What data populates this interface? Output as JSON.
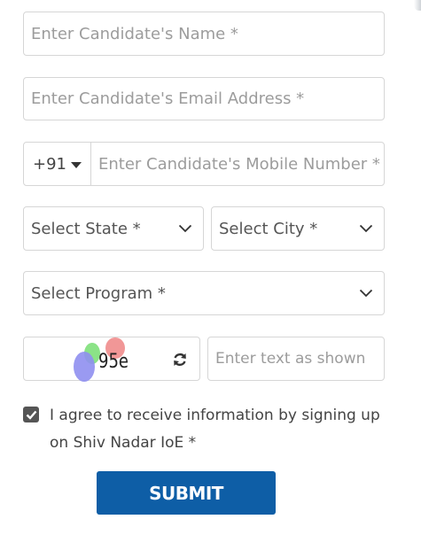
{
  "form": {
    "name_placeholder": "Enter Candidate's Name *",
    "email_placeholder": "Enter Candidate's Email Address *",
    "country_code": "+91",
    "mobile_placeholder": "Enter Candidate's Mobile Number *",
    "state_label": "Select State *",
    "city_label": "Select City *",
    "program_label": "Select Program *",
    "captcha_text": "95e",
    "captcha_input_placeholder": "Enter text as shown",
    "agree_checked": true,
    "agree_text": "I agree to receive information by signing up on Shiv Nadar IoE *",
    "submit_label": "SUBMIT"
  },
  "icons": {
    "dropdown": "chevron-down-icon",
    "refresh": "refresh-icon",
    "check": "check-icon"
  },
  "colors": {
    "submit_bg": "#0e5ea6",
    "border": "#d6d6d6",
    "placeholder": "#9c9c9c"
  }
}
